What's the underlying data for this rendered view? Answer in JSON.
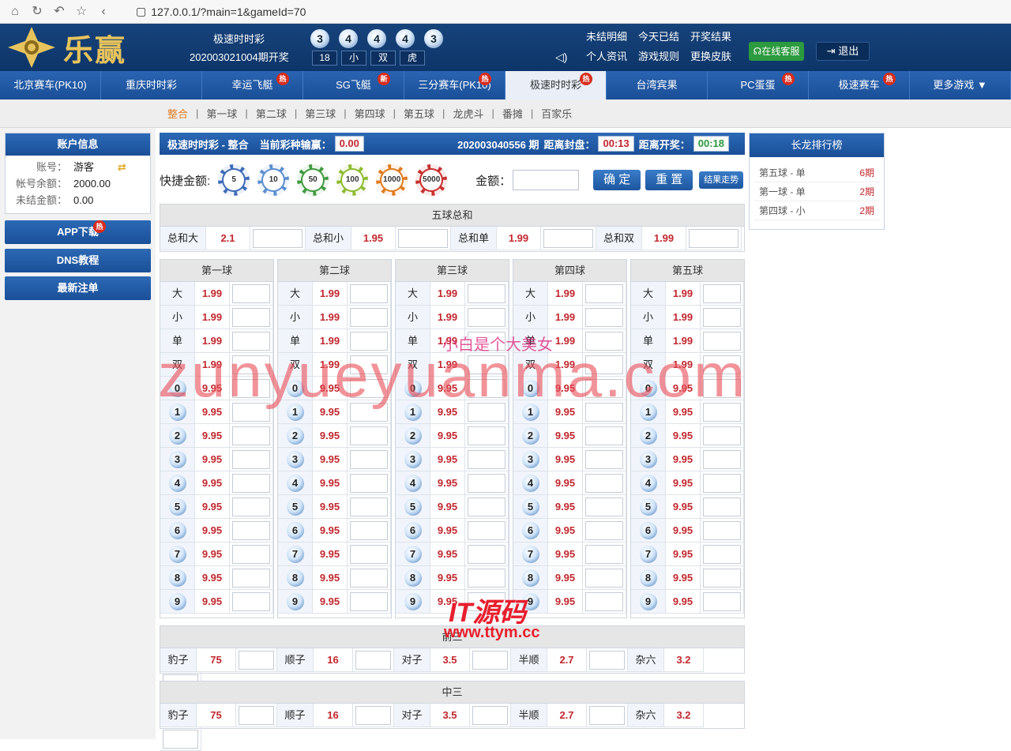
{
  "browser": {
    "url": "127.0.0.1/?main=1&gameId=70"
  },
  "header": {
    "logo_text": "乐赢",
    "lottery_name": "极速时时彩",
    "issue_text": "202003021004期开奖",
    "balls": [
      "3",
      "4",
      "4",
      "4",
      "3"
    ],
    "stats": [
      "18",
      "小",
      "双",
      "虎"
    ],
    "links": [
      "未结明细",
      "今天已结",
      "开奖结果",
      "个人资讯",
      "游戏规则",
      "更换皮肤"
    ],
    "service_label": "在线客服",
    "logout_label": "退出"
  },
  "nav": {
    "items": [
      {
        "label": "北京赛车(PK10)",
        "badge": ""
      },
      {
        "label": "重庆时时彩",
        "badge": ""
      },
      {
        "label": "幸运飞艇",
        "badge": "热"
      },
      {
        "label": "SG飞艇",
        "badge": "新"
      },
      {
        "label": "三分赛车(PK10)",
        "badge": "热"
      },
      {
        "label": "极速时时彩",
        "badge": "热"
      },
      {
        "label": "台湾宾果",
        "badge": ""
      },
      {
        "label": "PC蛋蛋",
        "badge": "热"
      },
      {
        "label": "极速赛车",
        "badge": "热"
      },
      {
        "label": "更多游戏 ▼",
        "badge": ""
      }
    ],
    "active_index": 5
  },
  "subnav": [
    "整合",
    "第一球",
    "第二球",
    "第三球",
    "第四球",
    "第五球",
    "龙虎斗",
    "番摊",
    "百家乐"
  ],
  "account": {
    "title": "账户信息",
    "rows": [
      {
        "k": "账号：",
        "v": "游客"
      },
      {
        "k": "帐号余额：",
        "v": "2000.00"
      },
      {
        "k": "未结金额：",
        "v": "0.00"
      }
    ]
  },
  "left_buttons": [
    "APP下载",
    "DNS教程",
    "最新注单"
  ],
  "app_badge": "热",
  "infobar": {
    "title": "极速时时彩 - 整合",
    "pl_label": "当前彩种输赢：",
    "pl_value": "0.00",
    "period": "202003040556 期",
    "close_label": "距离封盘：",
    "close_time": "00:13",
    "open_label": "距离开奖：",
    "open_time": "00:18"
  },
  "quickbet": {
    "label": "快捷金额:",
    "chips": [
      "5",
      "10",
      "50",
      "100",
      "1000",
      "5000"
    ],
    "amount_label": "金额：",
    "confirm": "确 定",
    "reset": "重 置",
    "trend": "结果走势"
  },
  "sum_table": {
    "title": "五球总和",
    "items": [
      {
        "label": "总和大",
        "odds": "2.1"
      },
      {
        "label": "总和小",
        "odds": "1.95"
      },
      {
        "label": "总和单",
        "odds": "1.99"
      },
      {
        "label": "总和双",
        "odds": "1.99"
      }
    ]
  },
  "ball_tables": {
    "titles": [
      "第一球",
      "第二球",
      "第三球",
      "第四球",
      "第五球"
    ],
    "rows": [
      {
        "label": "大",
        "odds": "1.99"
      },
      {
        "label": "小",
        "odds": "1.99"
      },
      {
        "label": "单",
        "odds": "1.99"
      },
      {
        "label": "双",
        "odds": "1.99"
      },
      {
        "label": "0",
        "odds": "9.95"
      },
      {
        "label": "1",
        "odds": "9.95"
      },
      {
        "label": "2",
        "odds": "9.95"
      },
      {
        "label": "3",
        "odds": "9.95"
      },
      {
        "label": "4",
        "odds": "9.95"
      },
      {
        "label": "5",
        "odds": "9.95"
      },
      {
        "label": "6",
        "odds": "9.95"
      },
      {
        "label": "7",
        "odds": "9.95"
      },
      {
        "label": "8",
        "odds": "9.95"
      },
      {
        "label": "9",
        "odds": "9.95"
      }
    ]
  },
  "front_table": {
    "title": "前三",
    "items": [
      {
        "label": "豹子",
        "odds": "75"
      },
      {
        "label": "顺子",
        "odds": "16"
      },
      {
        "label": "对子",
        "odds": "3.5"
      },
      {
        "label": "半顺",
        "odds": "2.7"
      },
      {
        "label": "杂六",
        "odds": "3.2"
      }
    ]
  },
  "mid_table": {
    "title": "中三",
    "items": [
      {
        "label": "豹子",
        "odds": "75"
      },
      {
        "label": "顺子",
        "odds": "16"
      },
      {
        "label": "对子",
        "odds": "3.5"
      },
      {
        "label": "半顺",
        "odds": "2.7"
      },
      {
        "label": "杂六",
        "odds": "3.2"
      }
    ]
  },
  "long_dragon": {
    "title": "长龙排行榜",
    "rows": [
      {
        "name": "第五球 - 单",
        "periods": "6期"
      },
      {
        "name": "第一球 - 单",
        "periods": "2期"
      },
      {
        "name": "第四球 - 小",
        "periods": "2期"
      }
    ]
  },
  "watermarks": {
    "main": "zunyueyuanma.com",
    "pink": "小白是个大美女",
    "site_name": "IT源码",
    "site_url": "www.ttym.cc"
  }
}
